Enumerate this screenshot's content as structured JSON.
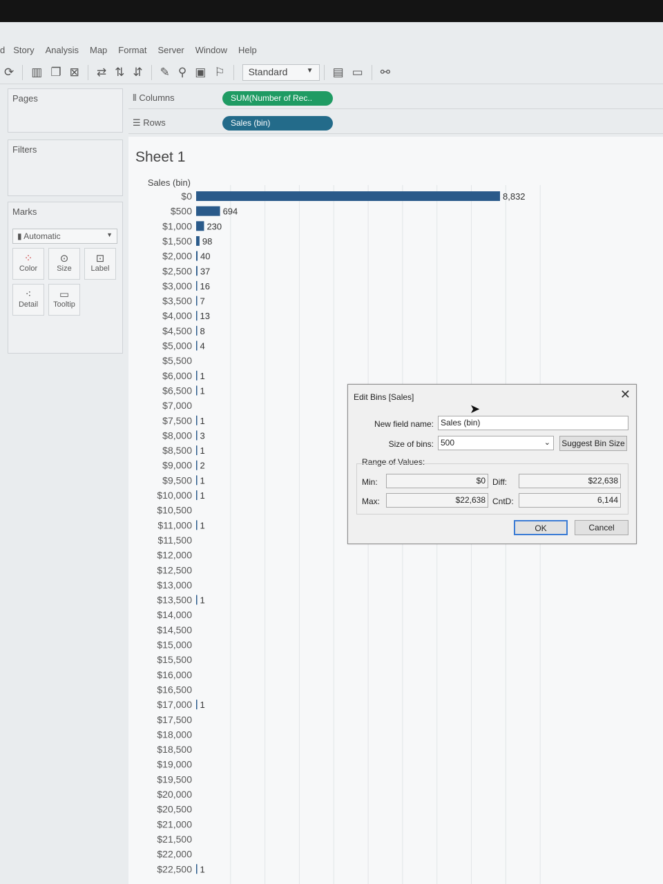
{
  "menu": {
    "items": [
      "d",
      "Story",
      "Analysis",
      "Map",
      "Format",
      "Server",
      "Window",
      "Help"
    ]
  },
  "toolbar": {
    "fit_select": "Standard",
    "icons": [
      "refresh-icon",
      "new-worksheet-icon",
      "duplicate-sheet-icon",
      "clear-sheet-icon",
      "swap-icon",
      "sort-ascending-icon",
      "sort-descending-icon",
      "highlight-icon",
      "group-icon",
      "label-icon",
      "pin-icon",
      "show-me-icon",
      "presentation-icon",
      "share-icon"
    ]
  },
  "pages": {
    "title": "Pages"
  },
  "filters": {
    "title": "Filters"
  },
  "marks": {
    "title": "Marks",
    "type_select": "Automatic",
    "cards": [
      {
        "label": "Color",
        "icon": "color-icon"
      },
      {
        "label": "Size",
        "icon": "size-icon"
      },
      {
        "label": "Label",
        "icon": "label-icon"
      },
      {
        "label": "Detail",
        "icon": "detail-icon"
      },
      {
        "label": "Tooltip",
        "icon": "tooltip-icon"
      }
    ]
  },
  "columns": {
    "label": "Columns",
    "pill": "SUM(Number of Rec.."
  },
  "rows": {
    "label": "Rows",
    "pill": "Sales (bin)"
  },
  "sheet": {
    "title": "Sheet 1"
  },
  "colors": {
    "bar": "#2a5a8a",
    "pill_green": "#1f9b63",
    "pill_blue": "#236b8a"
  },
  "chart_data": {
    "type": "bar",
    "orientation": "horizontal",
    "ylabel": "Sales (bin)",
    "categories": [
      "$0",
      "$500",
      "$1,000",
      "$1,500",
      "$2,000",
      "$2,500",
      "$3,000",
      "$3,500",
      "$4,000",
      "$4,500",
      "$5,000",
      "$5,500",
      "$6,000",
      "$6,500",
      "$7,000",
      "$7,500",
      "$8,000",
      "$8,500",
      "$9,000",
      "$9,500",
      "$10,000",
      "$10,500",
      "$11,000",
      "$11,500",
      "$12,000",
      "$12,500",
      "$13,000",
      "$13,500",
      "$14,000",
      "$14,500",
      "$15,000",
      "$15,500",
      "$16,000",
      "$16,500",
      "$17,000",
      "$17,500",
      "$18,000",
      "$18,500",
      "$19,000",
      "$19,500",
      "$20,000",
      "$20,500",
      "$21,000",
      "$21,500",
      "$22,000",
      "$22,500"
    ],
    "values": [
      8832,
      694,
      230,
      98,
      40,
      37,
      16,
      7,
      13,
      8,
      4,
      null,
      1,
      1,
      null,
      1,
      3,
      1,
      2,
      1,
      1,
      null,
      1,
      null,
      null,
      null,
      null,
      1,
      null,
      null,
      null,
      null,
      null,
      null,
      1,
      null,
      null,
      null,
      null,
      null,
      null,
      null,
      null,
      null,
      null,
      1
    ],
    "labels": [
      "8,832",
      "694",
      "230",
      "98",
      "40",
      "37",
      "16",
      "7",
      "13",
      "8",
      "4",
      "",
      "1",
      "1",
      "",
      "1",
      "3",
      "1",
      "2",
      "1",
      "1",
      "",
      "1",
      "",
      "",
      "",
      "",
      "1",
      "",
      "",
      "",
      "",
      "",
      "",
      "1",
      "",
      "",
      "",
      "",
      "",
      "",
      "",
      "",
      "",
      "",
      "1"
    ],
    "xlim": [
      0,
      10000
    ],
    "grid": true
  },
  "dialog": {
    "title": "Edit Bins [Sales]",
    "new_field_label": "New field name:",
    "new_field_value": "Sales (bin)",
    "bin_size_label": "Size of bins:",
    "bin_size_value": "500",
    "suggest_button": "Suggest Bin Size",
    "range_label": "Range of Values:",
    "min_label": "Min:",
    "min_value": "$0",
    "max_label": "Max:",
    "max_value": "$22,638",
    "diff_label": "Diff:",
    "diff_value": "$22,638",
    "cntd_label": "CntD:",
    "cntd_value": "6,144",
    "ok_button": "OK",
    "cancel_button": "Cancel"
  }
}
